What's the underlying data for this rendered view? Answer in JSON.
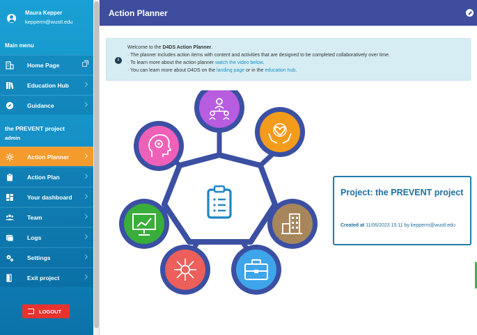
{
  "user": {
    "name": "Maura Kepper",
    "email": "kepperm@wustl.edu"
  },
  "main_menu": {
    "label": "Main menu",
    "items": [
      {
        "label": "Home Page",
        "icon": "building-icon",
        "external": true
      },
      {
        "label": "Education Hub",
        "icon": "books-icon"
      },
      {
        "label": "Guidance",
        "icon": "compass-icon"
      }
    ]
  },
  "project": {
    "title": "the PREVENT project",
    "role": "admin",
    "items": [
      {
        "label": "Action Planner",
        "icon": "sun-icon",
        "active": true
      },
      {
        "label": "Action Plan",
        "icon": "clipboard-icon"
      },
      {
        "label": "Your dashboard",
        "icon": "dashboard-icon"
      },
      {
        "label": "Team",
        "icon": "team-icon"
      },
      {
        "label": "Logs",
        "icon": "logs-icon"
      },
      {
        "label": "Settings",
        "icon": "settings-icon"
      },
      {
        "label": "Exit project",
        "icon": "door-icon"
      }
    ]
  },
  "logout_label": "LOGOUT",
  "header": {
    "title": "Action Planner"
  },
  "info": {
    "welcome_prefix": "Welcome to the ",
    "welcome_bold": "D4DS Action Planner",
    "welcome_suffix": ".",
    "line2": "· The planner includes action items with content and activities that are designed to be completed collaboratively over time.",
    "line3_prefix": "· To learn more about the action planner ",
    "line3_link": "watch the video below",
    "line3_suffix": ".",
    "line4_prefix": "· You can learn more about D4DS on the ",
    "line4_link1": "landing page",
    "line4_mid": " or in the ",
    "line4_link2": "education hub",
    "line4_suffix": "."
  },
  "diagram": {
    "nodes": [
      {
        "name": "team-node",
        "color": "#b85ce0",
        "icon": "people-network-icon"
      },
      {
        "name": "hands-heart-node",
        "color": "#f39b1b",
        "icon": "hands-heart-icon"
      },
      {
        "name": "building-node",
        "color": "#a8865c",
        "icon": "city-building-icon"
      },
      {
        "name": "briefcase-node",
        "color": "#3fa5ea",
        "icon": "briefcase-icon"
      },
      {
        "name": "distribution-node",
        "color": "#ec5f5a",
        "icon": "network-distribution-icon"
      },
      {
        "name": "presentation-node",
        "color": "#3aae3a",
        "icon": "presentation-chart-icon"
      },
      {
        "name": "mind-node",
        "color": "#ef60b9",
        "icon": "head-gear-icon"
      }
    ],
    "hub_icon": "clipboard-checklist-icon",
    "ring_color": "#3b50a3"
  },
  "card": {
    "title": "Project: the PREVENT project",
    "created_label": "Created at",
    "created_value": "11/06/2023 15:11 by kepperm@wustl.edu"
  }
}
